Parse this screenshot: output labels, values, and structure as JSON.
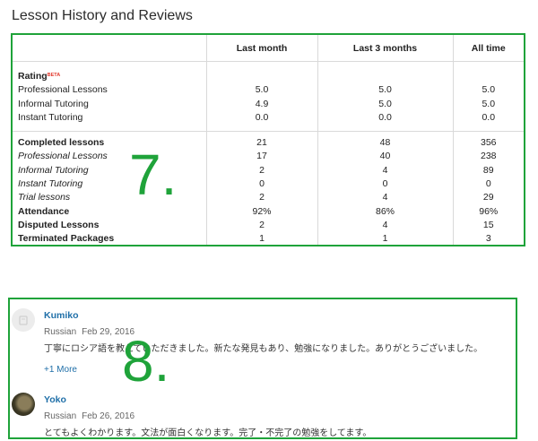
{
  "page_title": "Lesson History and Reviews",
  "stats": {
    "columns": [
      "",
      "Last month",
      "Last 3 months",
      "All time"
    ],
    "rating": {
      "label": "Rating",
      "beta": "BETA",
      "rows": [
        {
          "label": "Professional Lessons",
          "values": [
            "5.0",
            "5.0",
            "5.0"
          ]
        },
        {
          "label": "Informal Tutoring",
          "values": [
            "4.9",
            "5.0",
            "5.0"
          ]
        },
        {
          "label": "Instant Tutoring",
          "values": [
            "0.0",
            "0.0",
            "0.0"
          ]
        }
      ]
    },
    "lessons": [
      {
        "label": "Completed lessons",
        "values": [
          "21",
          "48",
          "356"
        ],
        "bold": true
      },
      {
        "label": "Professional Lessons",
        "values": [
          "17",
          "40",
          "238"
        ],
        "italic": true
      },
      {
        "label": "Informal Tutoring",
        "values": [
          "2",
          "4",
          "89"
        ],
        "italic": true
      },
      {
        "label": "Instant Tutoring",
        "values": [
          "0",
          "0",
          "0"
        ],
        "italic": true
      },
      {
        "label": "Trial lessons",
        "values": [
          "2",
          "4",
          "29"
        ],
        "italic": true
      },
      {
        "label": "Attendance",
        "values": [
          "92%",
          "86%",
          "96%"
        ],
        "bold": true
      },
      {
        "label": "Disputed Lessons",
        "values": [
          "2",
          "4",
          "15"
        ],
        "bold": true
      },
      {
        "label": "Terminated Packages",
        "values": [
          "1",
          "1",
          "3"
        ],
        "bold": true
      }
    ]
  },
  "annotations": {
    "seven": "7.",
    "eight": "8."
  },
  "reviews": [
    {
      "name": "Kumiko",
      "language": "Russian",
      "date": "Feb 29, 2016",
      "text": "丁寧にロシア語を教えていただきました。新たな発見もあり、勉強になりました。ありがとうございました。",
      "more": "+1 More"
    },
    {
      "name": "Yoko",
      "language": "Russian",
      "date": "Feb 26, 2016",
      "text": "とてもよくわかります。文法が面白くなります。完了・不完了の勉強をしてます。"
    }
  ],
  "colors": {
    "accent_green": "#1fa33a",
    "link_blue": "#1f6fa8",
    "beta_red": "#e23a2e"
  }
}
